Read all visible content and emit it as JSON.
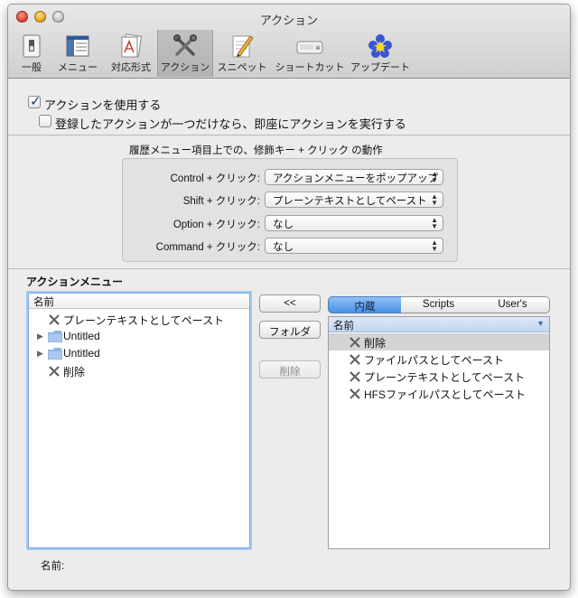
{
  "window": {
    "title": "アクション"
  },
  "toolbar": {
    "items": [
      {
        "label": "一般",
        "icon": "switch-icon"
      },
      {
        "label": "メニュー",
        "icon": "menu-icon"
      },
      {
        "label": "対応形式",
        "icon": "formats-icon"
      },
      {
        "label": "アクション",
        "icon": "tools-icon",
        "selected": true
      },
      {
        "label": "スニペット",
        "icon": "pencil-icon"
      },
      {
        "label": "ショートカット",
        "icon": "keyboard-icon"
      },
      {
        "label": "アップデート",
        "icon": "update-icon"
      }
    ]
  },
  "options": {
    "use_actions": {
      "label": "アクションを使用する",
      "checked": true
    },
    "run_immediately": {
      "label": "登録したアクションが一つだけなら、即座にアクションを実行する",
      "checked": false
    }
  },
  "modifier_group": {
    "title": "履歴メニュー項目上での、修飾キー + クリック の動作",
    "rows": [
      {
        "label": "Control + クリック:",
        "value": "アクションメニューをポップアップ"
      },
      {
        "label": "Shift + クリック:",
        "value": "プレーンテキストとしてペースト"
      },
      {
        "label": "Option + クリック:",
        "value": "なし"
      },
      {
        "label": "Command + クリック:",
        "value": "なし"
      }
    ]
  },
  "action_menu": {
    "section_title": "アクションメニュー",
    "column_header": "名前",
    "items": [
      {
        "label": "プレーンテキストとしてペースト",
        "type": "action"
      },
      {
        "label": "Untitled",
        "type": "folder"
      },
      {
        "label": "Untitled",
        "type": "folder"
      },
      {
        "label": "削除",
        "type": "action"
      }
    ],
    "name_label": "名前:"
  },
  "buttons": {
    "add": "<<",
    "folder": "フォルダ",
    "delete": "削除"
  },
  "source": {
    "tabs": [
      "内蔵",
      "Scripts",
      "User's"
    ],
    "selected_tab": "内蔵",
    "column_header": "名前",
    "items": [
      {
        "label": "削除",
        "selected": true
      },
      {
        "label": "ファイルパスとしてペースト"
      },
      {
        "label": "プレーンテキストとしてペースト"
      },
      {
        "label": "HFSファイルパスとしてペースト"
      }
    ]
  },
  "colors": {
    "accent": "#4a90e2",
    "selection": "#d4d4d4",
    "header_blue": "#c9daf2"
  }
}
